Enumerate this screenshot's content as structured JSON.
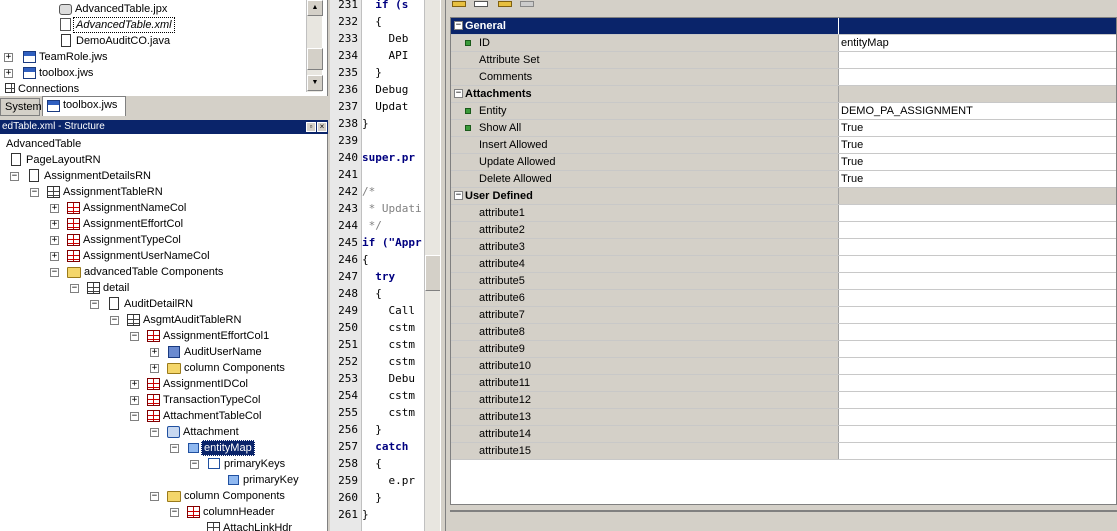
{
  "navigator": {
    "items": [
      {
        "label": "AdvancedTable.jpx",
        "icon": "gear-icon"
      },
      {
        "label": "AdvancedTable.xml",
        "icon": "xml-file-icon"
      },
      {
        "label": "DemoAuditCO.java",
        "icon": "java-file-icon"
      },
      {
        "label": "TeamRole.jws",
        "icon": "workspace-icon"
      },
      {
        "label": "toolbox.jws",
        "icon": "workspace-icon"
      },
      {
        "label": "Connections",
        "icon": "connections-icon"
      }
    ],
    "tabs": [
      {
        "label": "System"
      },
      {
        "label": "toolbox.jws"
      }
    ]
  },
  "structure": {
    "title": "edTable.xml - Structure",
    "nodes": [
      {
        "label": "AdvancedTable",
        "icon": "none"
      },
      {
        "label": "PageLayoutRN",
        "icon": "page-layout-icon"
      },
      {
        "label": "AssignmentDetailsRN",
        "icon": "region-icon"
      },
      {
        "label": "AssignmentTableRN",
        "icon": "table-icon"
      },
      {
        "label": "AssignmentNameCol",
        "icon": "column-icon"
      },
      {
        "label": "AssignmentEffortCol",
        "icon": "column-icon"
      },
      {
        "label": "AssignmentTypeCol",
        "icon": "column-icon"
      },
      {
        "label": "AssignmentUserNameCol",
        "icon": "column-icon"
      },
      {
        "label": "advancedTable Components",
        "icon": "folder-icon"
      },
      {
        "label": "detail",
        "icon": "detail-icon"
      },
      {
        "label": "AuditDetailRN",
        "icon": "region-icon"
      },
      {
        "label": "AsgmtAuditTableRN",
        "icon": "table-icon"
      },
      {
        "label": "AssignmentEffortCol1",
        "icon": "column-icon"
      },
      {
        "label": "AuditUserName",
        "icon": "item-icon"
      },
      {
        "label": "column Components",
        "icon": "folder-icon"
      },
      {
        "label": "AssignmentIDCol",
        "icon": "column-icon"
      },
      {
        "label": "TransactionTypeCol",
        "icon": "column-icon"
      },
      {
        "label": "AttachmentTableCol",
        "icon": "column-icon"
      },
      {
        "label": "Attachment",
        "icon": "attachment-icon"
      },
      {
        "label": "entityMap",
        "icon": "entity-map-icon"
      },
      {
        "label": "primaryKeys",
        "icon": "keys-icon"
      },
      {
        "label": "primaryKey",
        "icon": "key-icon"
      },
      {
        "label": "column Components",
        "icon": "folder-icon"
      },
      {
        "label": "columnHeader",
        "icon": "column-icon"
      },
      {
        "label": "AttachLinkHdr",
        "icon": "table-icon"
      }
    ]
  },
  "editor": {
    "line_numbers": [
      "231",
      "232",
      "233",
      "234",
      "235",
      "236",
      "237",
      "238",
      "239",
      "240",
      "241",
      "242",
      "243",
      "244",
      "245",
      "246",
      "247",
      "248",
      "249",
      "250",
      "251",
      "252",
      "253",
      "254",
      "255",
      "256",
      "257",
      "258",
      "259",
      "260",
      "261"
    ],
    "lines": [
      "  if (s",
      "  {",
      "    Deb",
      "    API",
      "  }",
      "  Debug",
      "  Updat",
      "}",
      "",
      "super.pr",
      "",
      "/*",
      " * Updati",
      " */",
      "if (\"Appr",
      "{",
      "  try",
      "  {",
      "    Call",
      "    cstm",
      "    cstm",
      "    cstm",
      "    Debu",
      "    cstm",
      "    cstm",
      "  }",
      "  catch",
      "  {",
      "    e.pr",
      "  }",
      "}"
    ]
  },
  "inspector": {
    "categories": [
      {
        "name": "General",
        "rows": [
          {
            "name": "ID",
            "value": "entityMap",
            "required": true
          },
          {
            "name": "Attribute Set",
            "value": "",
            "required": false
          },
          {
            "name": "Comments",
            "value": "",
            "required": false
          }
        ]
      },
      {
        "name": "Attachments",
        "rows": [
          {
            "name": "Entity",
            "value": "DEMO_PA_ASSIGNMENT",
            "required": true
          },
          {
            "name": "Show All",
            "value": "True",
            "required": true
          },
          {
            "name": "Insert Allowed",
            "value": "True",
            "required": false
          },
          {
            "name": "Update Allowed",
            "value": "True",
            "required": false
          },
          {
            "name": "Delete Allowed",
            "value": "True",
            "required": false
          }
        ]
      },
      {
        "name": "User Defined",
        "rows": [
          {
            "name": "attribute1",
            "value": ""
          },
          {
            "name": "attribute2",
            "value": ""
          },
          {
            "name": "attribute3",
            "value": ""
          },
          {
            "name": "attribute4",
            "value": ""
          },
          {
            "name": "attribute5",
            "value": ""
          },
          {
            "name": "attribute6",
            "value": ""
          },
          {
            "name": "attribute7",
            "value": ""
          },
          {
            "name": "attribute8",
            "value": ""
          },
          {
            "name": "attribute9",
            "value": ""
          },
          {
            "name": "attribute10",
            "value": ""
          },
          {
            "name": "attribute11",
            "value": ""
          },
          {
            "name": "attribute12",
            "value": ""
          },
          {
            "name": "attribute13",
            "value": ""
          },
          {
            "name": "attribute14",
            "value": ""
          },
          {
            "name": "attribute15",
            "value": ""
          }
        ]
      }
    ]
  },
  "colors": {
    "selection": "#0a246a",
    "panel": "#d4d0c8",
    "required_bullet": "#3a9a3a"
  }
}
